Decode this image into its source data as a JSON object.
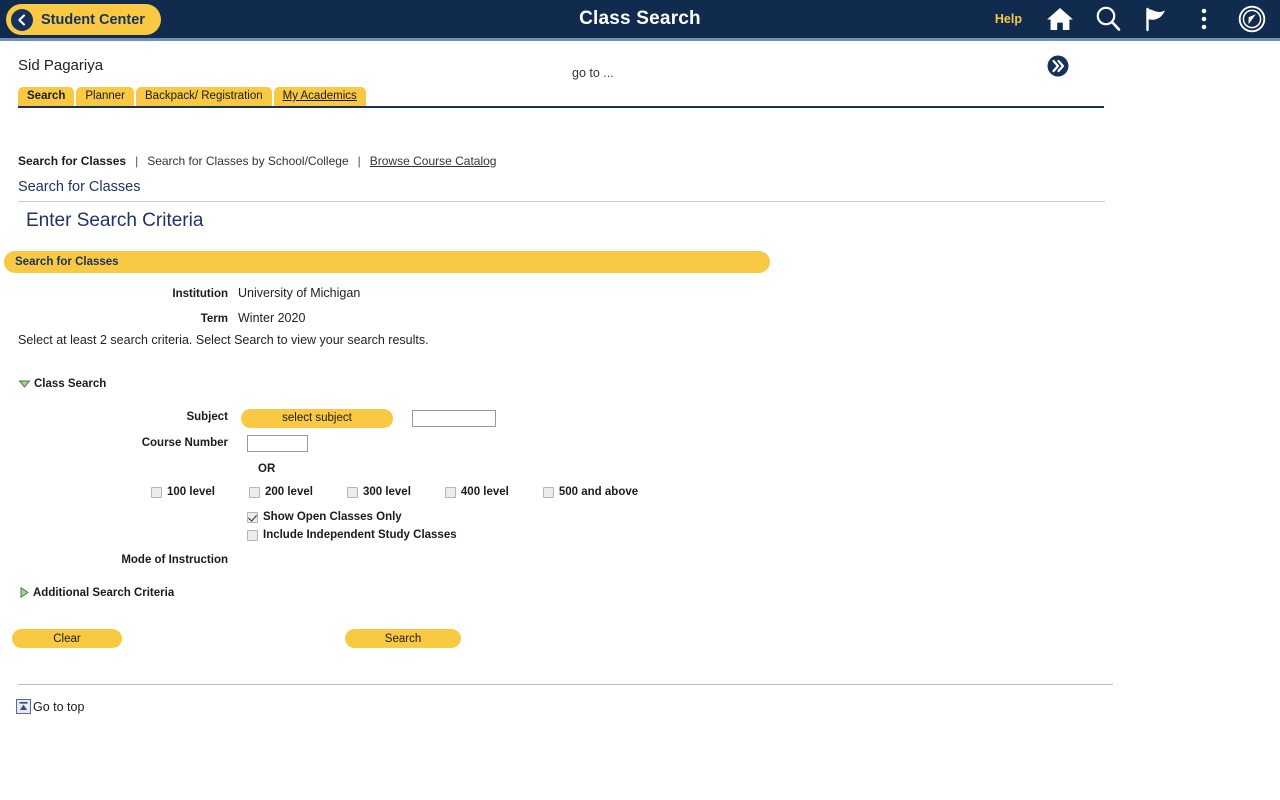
{
  "appbar": {
    "back_label": "Student Center",
    "back_icon": "chevron-left-icon",
    "title": "Class Search",
    "help_label": "Help",
    "icons": [
      "home-icon",
      "search-icon",
      "flag-icon",
      "more-vertical-icon",
      "compass-icon"
    ]
  },
  "page": {
    "user_name": "Sid Pagariya",
    "goto_text": "go to ...",
    "goto_icon": "double-chevron-right-icon"
  },
  "tabs": [
    {
      "label": "Search",
      "active": true
    },
    {
      "label": "Planner",
      "active": false
    },
    {
      "label": "Backpack/ Registration",
      "active": false
    },
    {
      "label": "My Academics",
      "active": false,
      "accesskey": "M"
    }
  ],
  "subnav": [
    {
      "label": "Search for Classes",
      "active": true
    },
    {
      "label": "Search for Classes by School/College",
      "active": false
    },
    {
      "label": "Browse Course Catalog",
      "active": false,
      "accesskey": "B"
    }
  ],
  "breadcrumb": "Search for Classes",
  "heading": "Enter Search Criteria",
  "section": {
    "title": "Search for Classes",
    "institution_label": "Institution",
    "institution_value": "University of Michigan",
    "term_label": "Term",
    "term_value": "Winter 2020",
    "hint": "Select at least 2 search criteria. Select Search to view your search results."
  },
  "class_search": {
    "group_label": "Class Search",
    "expanded": true,
    "subject_label": "Subject",
    "subject_button": "select subject",
    "subject_value": "",
    "subject_placeholder": "",
    "course_number_label": "Course Number",
    "course_number_value": "",
    "or_label": "OR",
    "levels": [
      {
        "label": "100 level",
        "checked": false
      },
      {
        "label": "200 level",
        "checked": false
      },
      {
        "label": "300 level",
        "checked": false
      },
      {
        "label": "400 level",
        "checked": false
      },
      {
        "label": "500 and above",
        "checked": false
      }
    ],
    "show_open_label": "Show Open Classes Only",
    "show_open_checked": true,
    "include_independent_label": "Include Independent Study Classes",
    "include_independent_checked": false,
    "mode_of_instruction_label": "Mode of Instruction"
  },
  "additional": {
    "group_label": "Additional Search Criteria",
    "expanded": false
  },
  "actions": {
    "clear_label": "Clear",
    "search_label": "Search"
  },
  "footer": {
    "go_to_top_label": "Go to top",
    "go_to_top_icon": "go-to-top-icon"
  },
  "colors": {
    "navy": "#102B4E",
    "gold": "#F9C944",
    "link_navy": "#1F3368",
    "accent_line": "#6F91BA"
  }
}
